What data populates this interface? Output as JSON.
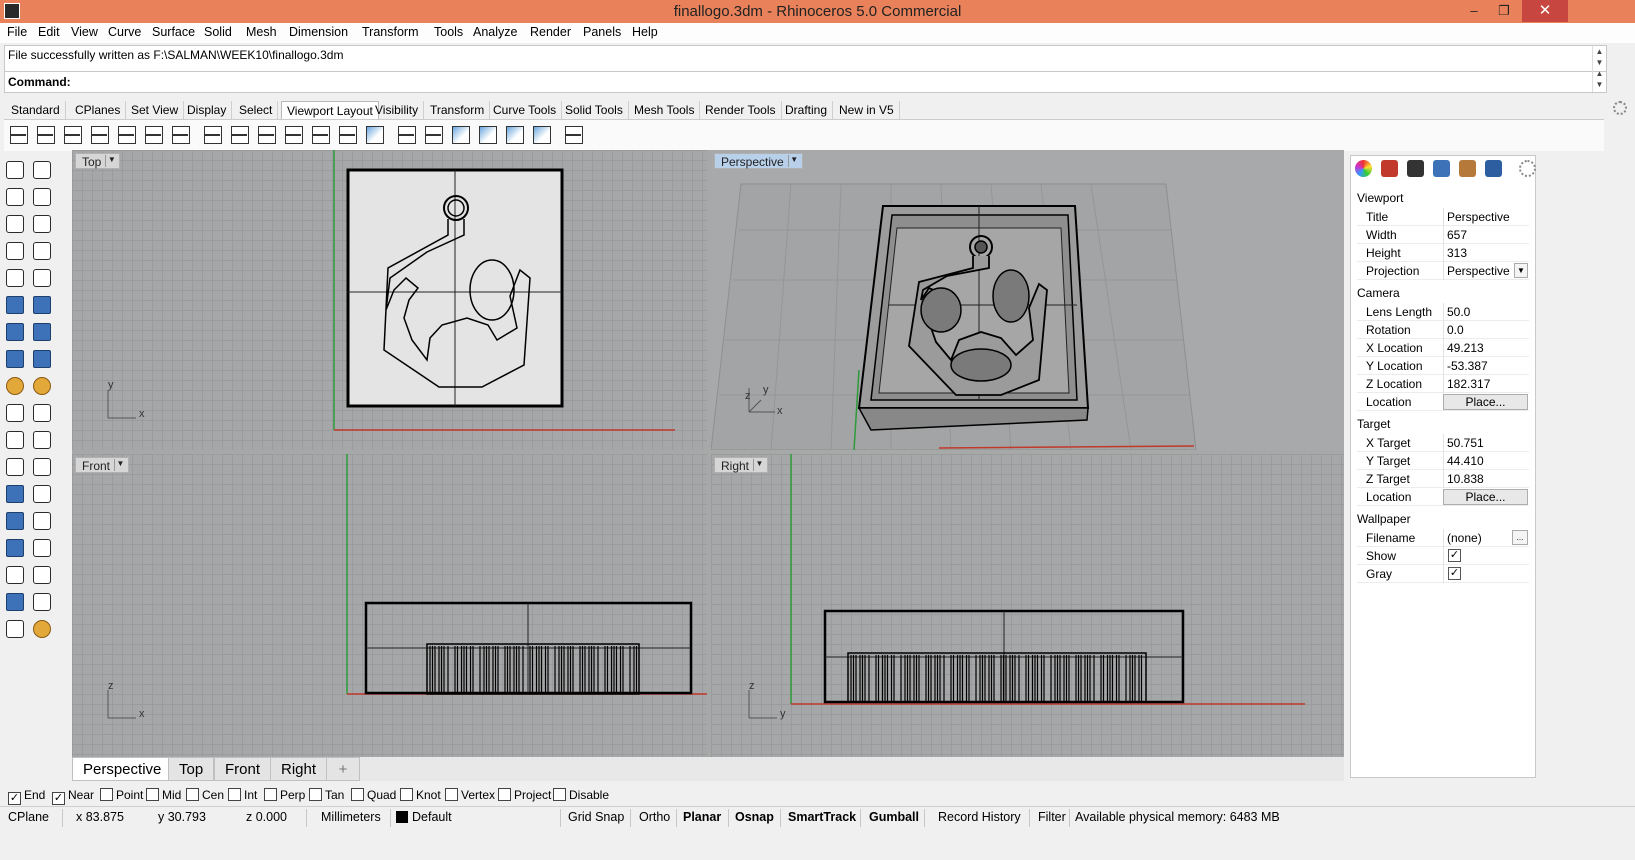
{
  "window": {
    "title": "finallogo.3dm - Rhinoceros 5.0 Commercial",
    "min": "–",
    "max": "❐",
    "close": "✕"
  },
  "menu": [
    "File",
    "Edit",
    "View",
    "Curve",
    "Surface",
    "Solid",
    "Mesh",
    "Dimension",
    "Transform",
    "Tools",
    "Analyze",
    "Render",
    "Panels",
    "Help"
  ],
  "command": {
    "history": "File successfully written as F:\\SALMAN\\WEEK10\\finallogo.3dm",
    "label": "Command:",
    "value": ""
  },
  "tabs": [
    "Standard",
    "CPlanes",
    "Set View",
    "Display",
    "Select",
    "Viewport Layout",
    "Visibility",
    "Transform",
    "Curve Tools",
    "Solid Tools",
    "Mesh Tools",
    "Render Tools",
    "Drafting",
    "New in V5"
  ],
  "active_tab": "Viewport Layout",
  "viewports": {
    "top": {
      "label": "Top",
      "axis_a": "y",
      "axis_b": "x"
    },
    "perspective": {
      "label": "Perspective",
      "axis_a": "z",
      "axis_b": "y",
      "axis_c": "x"
    },
    "front": {
      "label": "Front",
      "axis_a": "z",
      "axis_b": "x"
    },
    "right": {
      "label": "Right",
      "axis_a": "z",
      "axis_b": "y"
    }
  },
  "viewport_tabs": [
    "Perspective",
    "Top",
    "Front",
    "Right",
    "+"
  ],
  "properties": {
    "viewport_header": "Viewport",
    "title_label": "Title",
    "title_value": "Perspective",
    "width_label": "Width",
    "width_value": "657",
    "height_label": "Height",
    "height_value": "313",
    "projection_label": "Projection",
    "projection_value": "Perspective",
    "camera_header": "Camera",
    "lens_label": "Lens Length",
    "lens_value": "50.0",
    "rotation_label": "Rotation",
    "rotation_value": "0.0",
    "xloc_label": "X Location",
    "xloc_value": "49.213",
    "yloc_label": "Y Location",
    "yloc_value": "-53.387",
    "zloc_label": "Z Location",
    "zloc_value": "182.317",
    "location_label": "Location",
    "place_label": "Place...",
    "target_header": "Target",
    "xt_label": "X Target",
    "xt_value": "50.751",
    "yt_label": "Y Target",
    "yt_value": "44.410",
    "zt_label": "Z Target",
    "zt_value": "10.838",
    "tlocation_label": "Location",
    "tplace_label": "Place...",
    "wallpaper_header": "Wallpaper",
    "filename_label": "Filename",
    "filename_value": "(none)",
    "browse_label": "...",
    "show_label": "Show",
    "show_checked": true,
    "gray_label": "Gray",
    "gray_checked": true
  },
  "osnaps": [
    {
      "label": "End",
      "checked": true
    },
    {
      "label": "Near",
      "checked": true
    },
    {
      "label": "Point",
      "checked": false
    },
    {
      "label": "Mid",
      "checked": false
    },
    {
      "label": "Cen",
      "checked": false
    },
    {
      "label": "Int",
      "checked": false
    },
    {
      "label": "Perp",
      "checked": false
    },
    {
      "label": "Tan",
      "checked": false
    },
    {
      "label": "Quad",
      "checked": false
    },
    {
      "label": "Knot",
      "checked": false
    },
    {
      "label": "Vertex",
      "checked": false
    },
    {
      "label": "Project",
      "checked": false
    },
    {
      "label": "Disable",
      "checked": false
    }
  ],
  "status": {
    "cplane": "CPlane",
    "x": "x 83.875",
    "y": "y 30.793",
    "z": "z 0.000",
    "units": "Millimeters",
    "layer": "Default",
    "grid_snap": "Grid Snap",
    "ortho": "Ortho",
    "planar": "Planar",
    "osnap": "Osnap",
    "smarttrack": "SmartTrack",
    "gumball": "Gumball",
    "record_history": "Record History",
    "filter": "Filter",
    "memory": "Available physical memory: 6483 MB"
  },
  "colors": {
    "titlebar": "#e9825a",
    "viewport_bg": "#a6a7a8",
    "x_axis": "#c0392b",
    "y_axis": "#2e9b3a",
    "active_viewport": "#b9d0ea"
  }
}
